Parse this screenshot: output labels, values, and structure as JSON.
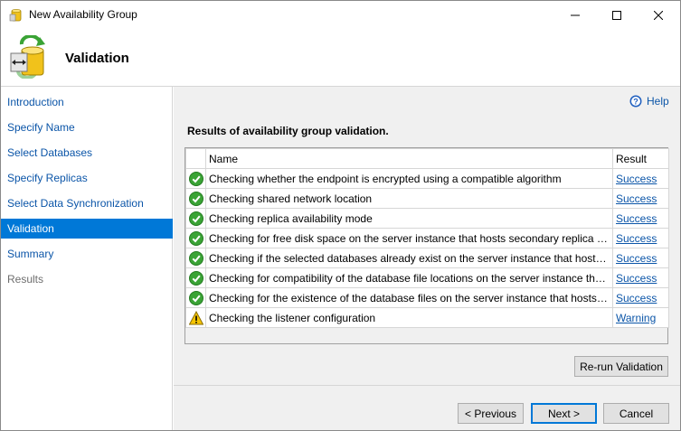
{
  "window": {
    "title": "New Availability Group",
    "icon": "database-app-icon"
  },
  "header": {
    "title": "Validation",
    "icon": "validation-database-icon"
  },
  "sidebar": {
    "items": [
      {
        "label": "Introduction",
        "state": "link"
      },
      {
        "label": "Specify Name",
        "state": "link"
      },
      {
        "label": "Select Databases",
        "state": "link"
      },
      {
        "label": "Specify Replicas",
        "state": "link"
      },
      {
        "label": "Select Data Synchronization",
        "state": "link"
      },
      {
        "label": "Validation",
        "state": "active"
      },
      {
        "label": "Summary",
        "state": "link"
      },
      {
        "label": "Results",
        "state": "disabled"
      }
    ]
  },
  "main": {
    "help_label": "Help",
    "results_title": "Results of availability group validation.",
    "columns": {
      "name": "Name",
      "result": "Result"
    },
    "rows": [
      {
        "status": "success",
        "name": "Checking whether the endpoint is encrypted using a compatible algorithm",
        "result": "Success"
      },
      {
        "status": "success",
        "name": "Checking shared network location",
        "result": "Success"
      },
      {
        "status": "success",
        "name": "Checking replica availability mode",
        "result": "Success"
      },
      {
        "status": "success",
        "name": "Checking for free disk space on the server instance that hosts secondary replica S...",
        "result": "Success"
      },
      {
        "status": "success",
        "name": "Checking if the selected databases already exist on the server instance that hosts s...",
        "result": "Success"
      },
      {
        "status": "success",
        "name": "Checking for compatibility of the database file locations on the server instance tha...",
        "result": "Success"
      },
      {
        "status": "success",
        "name": "Checking for the existence of the database files on the server instance that hosts s...",
        "result": "Success"
      },
      {
        "status": "warning",
        "name": "Checking the listener configuration",
        "result": "Warning"
      }
    ],
    "rerun_label": "Re-run Validation"
  },
  "footer": {
    "previous_label": "< Previous",
    "next_label": "Next >",
    "cancel_label": "Cancel"
  },
  "colors": {
    "accent": "#0078d7",
    "link": "#0b55a8",
    "success": "#3aa335",
    "warning": "#f5c400"
  }
}
